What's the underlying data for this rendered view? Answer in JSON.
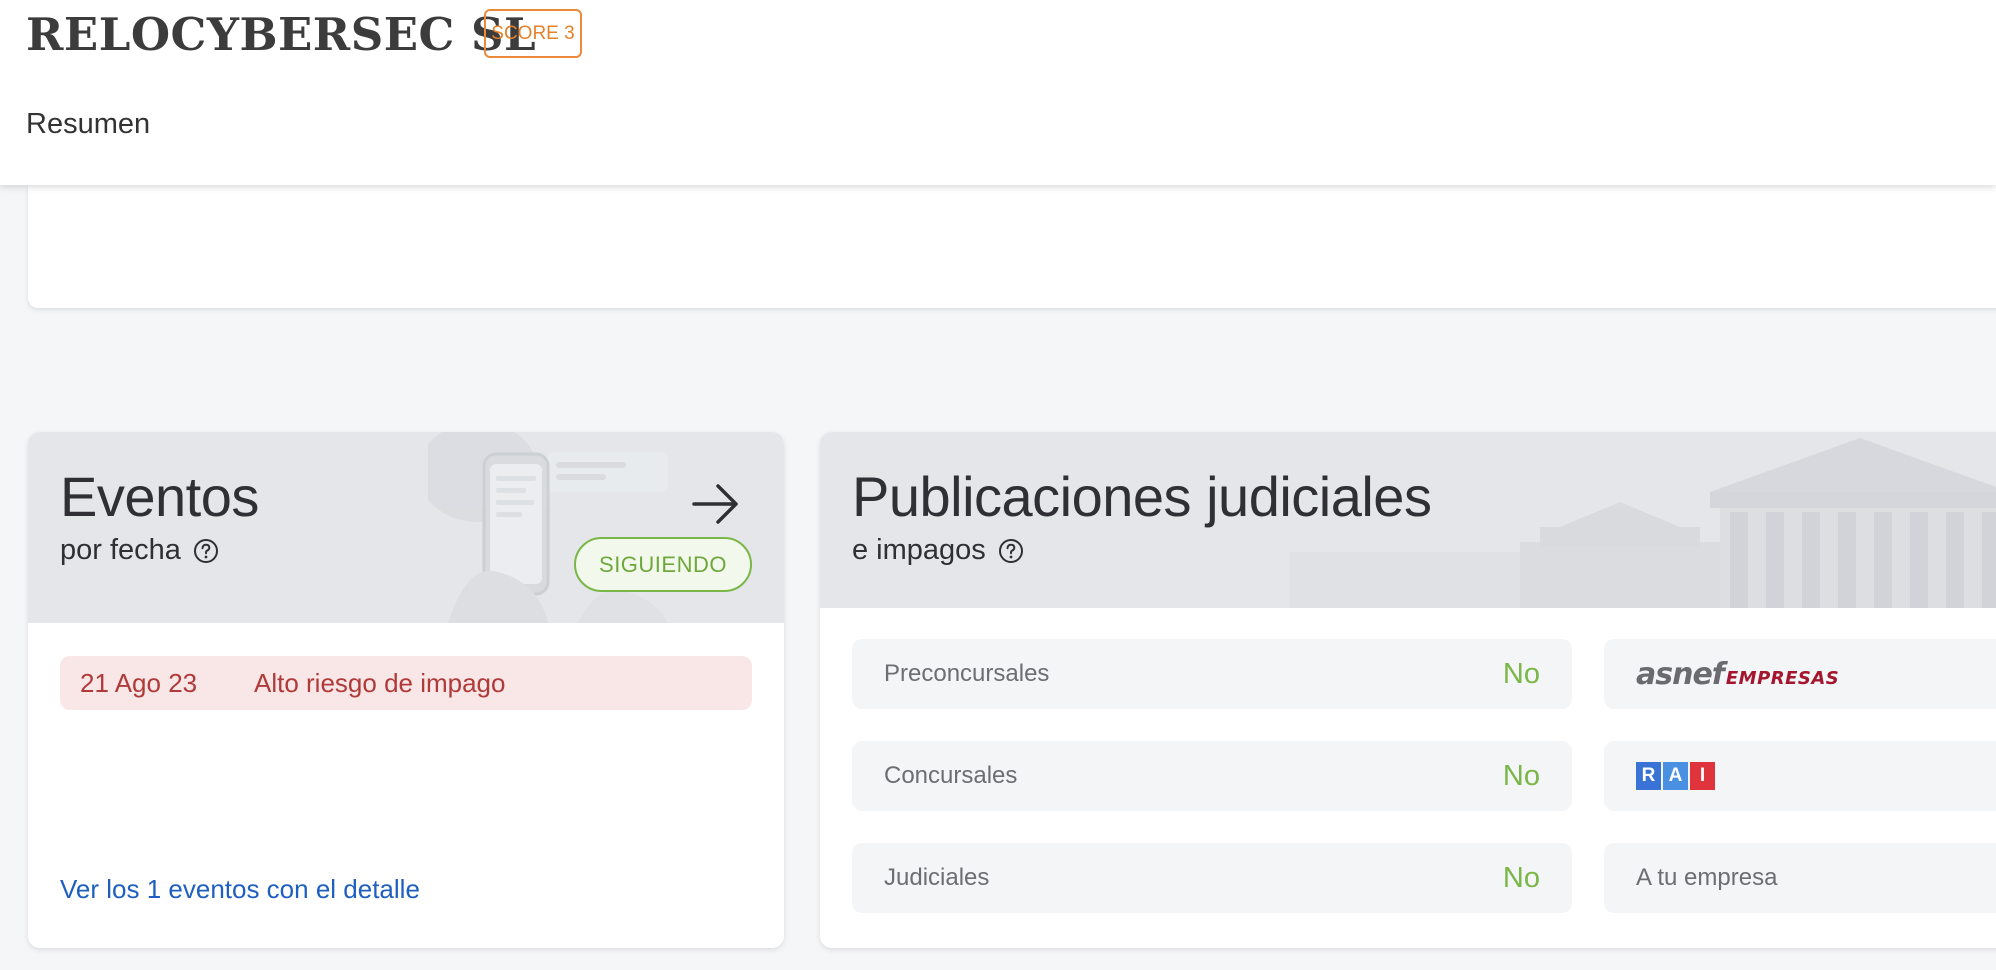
{
  "header": {
    "company_name": "RELOCYBERSEC SL",
    "score_badge": "SCORE 3",
    "tab_label": "Resumen"
  },
  "colors": {
    "accent_orange": "#e5812a",
    "follow_green": "#7ab648",
    "risk_red": "#b03a3a",
    "link_blue": "#1f5fbf"
  },
  "events": {
    "title": "Eventos",
    "subtitle": "por fecha",
    "follow_label": "SIGUIENDO",
    "items": [
      {
        "date": "21 Ago 23",
        "text": "Alto riesgo de impago"
      }
    ],
    "link_label": "Ver los 1 eventos con el detalle",
    "icons": {
      "help": "help-circle-icon",
      "arrow": "arrow-right-icon"
    }
  },
  "publications": {
    "title": "Publicaciones judiciales",
    "subtitle": "e impagos",
    "rows": [
      {
        "label": "Preconcursales",
        "value": "No"
      },
      {
        "label": "Concursales",
        "value": "No"
      },
      {
        "label": "Judiciales",
        "value": "No"
      }
    ],
    "right_rows": {
      "asnef_part1": "asnef",
      "asnef_part2": "EMPRESAS",
      "rai_letters": [
        "R",
        "A",
        "I"
      ],
      "rai_colors": [
        "#3a73d6",
        "#4a90e2",
        "#e0343c"
      ],
      "company_label": "A tu empresa"
    }
  }
}
